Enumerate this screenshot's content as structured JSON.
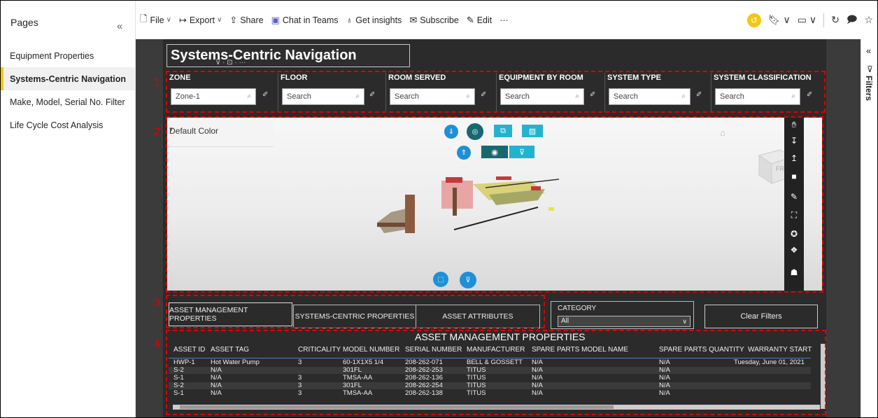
{
  "pages": {
    "heading": "Pages",
    "items": [
      {
        "label": "Equipment Properties",
        "active": false
      },
      {
        "label": "Systems-Centric Navigation",
        "active": true
      },
      {
        "label": "Make, Model, Serial No. Filter",
        "active": false
      },
      {
        "label": "Life Cycle Cost Analysis",
        "active": false
      }
    ]
  },
  "toolbar": {
    "file": "File",
    "export": "Export",
    "share": "Share",
    "chat": "Chat in Teams",
    "insights": "Get insights",
    "subscribe": "Subscribe",
    "edit": "Edit",
    "more": "···"
  },
  "filters_pane": {
    "label": "Filters"
  },
  "report": {
    "title": "Systems-Centric Navigation",
    "slicers": [
      {
        "title": "ZONE",
        "value": "Zone-1",
        "placeholder": "Search"
      },
      {
        "title": "FLOOR",
        "value": "",
        "placeholder": "Search"
      },
      {
        "title": "ROOM SERVED",
        "value": "",
        "placeholder": "Search"
      },
      {
        "title": "EQUIPMENT BY ROOM",
        "value": "",
        "placeholder": "Search"
      },
      {
        "title": "SYSTEM TYPE",
        "value": "",
        "placeholder": "Search"
      },
      {
        "title": "SYSTEM CLASSIFICATION",
        "value": "",
        "placeholder": "Search"
      }
    ],
    "viewer": {
      "color_mode": "Default Color",
      "cube_label": "FRO"
    },
    "tabs": [
      "ASSET MANAGEMENT PROPERTIES",
      "SYSTEMS-CENTRIC PROPERTIES",
      "ASSET ATTRIBUTES"
    ],
    "category": {
      "label": "CATEGORY",
      "value": "All"
    },
    "clear_filters": "Clear Filters",
    "table": {
      "title": "ASSET MANAGEMENT PROPERTIES",
      "columns": [
        "ASSET ID",
        "ASSET TAG",
        "CRITICALITY",
        "MODEL NUMBER",
        "SERIAL NUMBER",
        "MANUFACTURER",
        "SPARE PARTS MODEL NAME",
        "SPARE PARTS QUANTITY",
        "WARRANTY START"
      ],
      "rows": [
        [
          "HWP-1",
          "Hot Water Pump",
          "3",
          "60-1X1X5 1/4",
          "208-262-071",
          "BELL & GOSSETT",
          "N/A",
          "N/A",
          "Tuesday, June 01, 2021"
        ],
        [
          "S-2",
          "N/A",
          "",
          "301FL",
          "208-262-253",
          "TITUS",
          "N/A",
          "N/A",
          ""
        ],
        [
          "S-1",
          "N/A",
          "3",
          "TMSA-AA",
          "208-262-136",
          "TITUS",
          "N/A",
          "N/A",
          ""
        ],
        [
          "S-2",
          "N/A",
          "3",
          "301FL",
          "208-262-254",
          "TITUS",
          "N/A",
          "N/A",
          ""
        ],
        [
          "S-1",
          "N/A",
          "3",
          "TMSA-AA",
          "208-262-138",
          "TITUS",
          "N/A",
          "N/A",
          ""
        ]
      ]
    }
  },
  "annotations": [
    "1",
    "2",
    "3",
    "4"
  ],
  "colors": {
    "annotation": "#e00000",
    "active_page_marker": "#f2c811",
    "viewer_button": "#1e90d6"
  }
}
